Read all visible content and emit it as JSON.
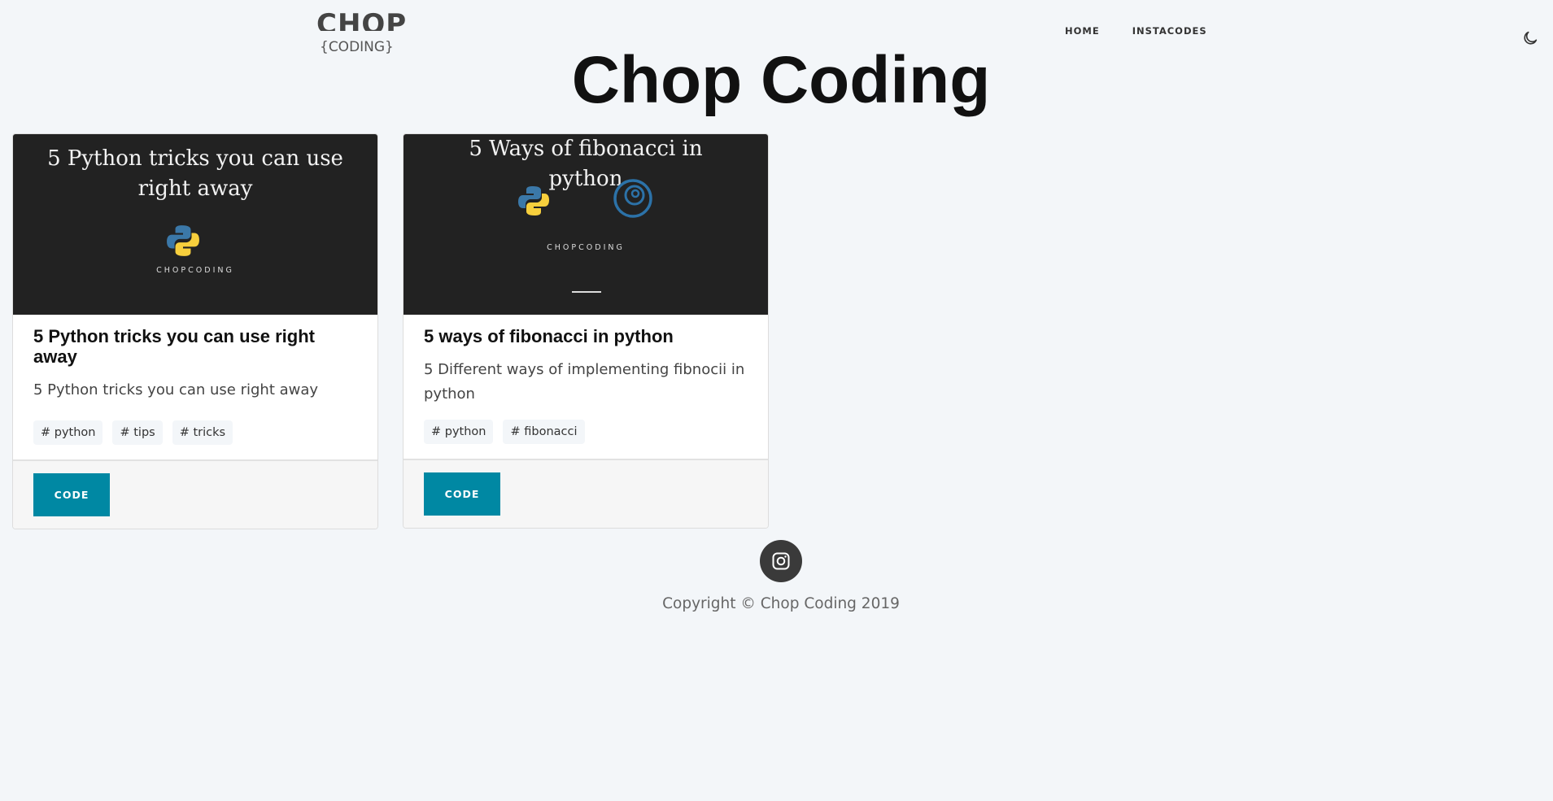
{
  "header": {
    "logo_top": "CHOP",
    "logo_bottom": "{CODING}",
    "nav": [
      {
        "label": "HOME"
      },
      {
        "label": "INSTACODES"
      }
    ],
    "theme_icon": "moon-icon"
  },
  "page_title": "Chop Coding",
  "cards": [
    {
      "image_title": "5 Python tricks you can use right away",
      "image_brand": "CHOPCODING",
      "title": "5 Python tricks you can use right away",
      "description": "5 Python tricks you can use right away",
      "tags": [
        "# python",
        "# tips",
        "# tricks"
      ],
      "button": "CODE"
    },
    {
      "image_title": "5 Ways of fibonacci in python",
      "image_brand": "CHOPCODING",
      "title": "5 ways of fibonacci in python",
      "description": "5 Different ways of implementing fibnocii in python",
      "tags": [
        "# python",
        "# fibonacci"
      ],
      "button": "CODE"
    }
  ],
  "footer": {
    "social_icon": "instagram-icon",
    "copyright": "Copyright © Chop Coding 2019"
  },
  "colors": {
    "accent": "#0088a3",
    "background": "#f3f6f9",
    "thumb": "#222222"
  }
}
